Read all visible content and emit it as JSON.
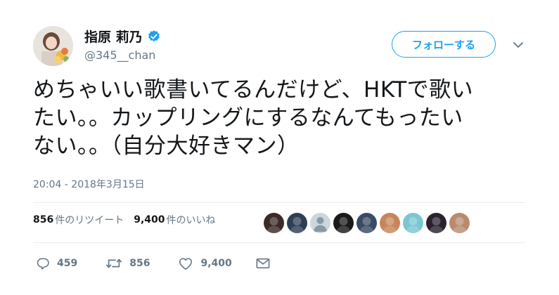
{
  "user": {
    "display_name": "指原 莉乃",
    "handle": "@345__chan",
    "verified": true
  },
  "follow_button": {
    "label": "フォローする"
  },
  "tweet": {
    "lines": [
      "めちゃいい歌書いてるんだけど、HKTで歌い",
      "たい。。カップリングにするなんてもったい",
      "ない。。（自分大好きマン）"
    ],
    "timestamp": "20:04 - 2018年3月15日"
  },
  "stats": {
    "retweets_count": "856",
    "retweets_label": "件のリツイート",
    "likes_count": "9,400",
    "likes_label": "件のいいね"
  },
  "likers": [
    {
      "icon": "liker-avatar-1",
      "color": "#3b2a25"
    },
    {
      "icon": "liker-avatar-2",
      "color": "#2e3e55"
    },
    {
      "icon": "liker-avatar-default",
      "color": "#ccd6dd"
    },
    {
      "icon": "liker-avatar-4",
      "color": "#1a1a1a"
    },
    {
      "icon": "liker-avatar-5",
      "color": "#3a4a63"
    },
    {
      "icon": "liker-avatar-6",
      "color": "#c7865a"
    },
    {
      "icon": "liker-avatar-7",
      "color": "#79c7d2"
    },
    {
      "icon": "liker-avatar-8",
      "color": "#2b2230"
    },
    {
      "icon": "liker-avatar-9",
      "color": "#b98b6c"
    }
  ],
  "actions": {
    "reply_count": "459",
    "retweet_count": "856",
    "like_count": "9,400"
  },
  "colors": {
    "accent": "#1da1f2",
    "muted": "#657786",
    "text": "#14171a",
    "divider": "#e6ecf0"
  }
}
